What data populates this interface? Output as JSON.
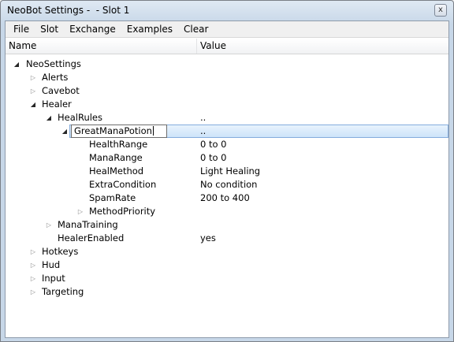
{
  "window": {
    "title": "NeoBot Settings -  - Slot 1",
    "close_label": "x"
  },
  "menu": [
    "File",
    "Slot",
    "Exchange",
    "Examples",
    "Clear"
  ],
  "columns": {
    "name": "Name",
    "value": "Value"
  },
  "tree": {
    "root": "NeoSettings",
    "alerts": "Alerts",
    "cavebot": "Cavebot",
    "healer": "Healer",
    "heal_rules": {
      "name": "HealRules",
      "value": ".."
    },
    "great_mana_potion": {
      "name": "GreatManaPotion",
      "value": ".."
    },
    "health_range": {
      "name": "HealthRange",
      "value": "0 to 0"
    },
    "mana_range": {
      "name": "ManaRange",
      "value": "0 to 0"
    },
    "heal_method": {
      "name": "HealMethod",
      "value": "Light Healing"
    },
    "extra_condition": {
      "name": "ExtraCondition",
      "value": "No condition"
    },
    "spam_rate": {
      "name": "SpamRate",
      "value": "200 to 400"
    },
    "method_priority": "MethodPriority",
    "mana_training": "ManaTraining",
    "healer_enabled": {
      "name": "HealerEnabled",
      "value": "yes"
    },
    "hotkeys": "Hotkeys",
    "hud": "Hud",
    "input": "Input",
    "targeting": "Targeting"
  },
  "icons": {
    "expanded": "expanded-triangle-icon",
    "collapsed": "collapsed-triangle-icon",
    "close": "close-icon"
  }
}
